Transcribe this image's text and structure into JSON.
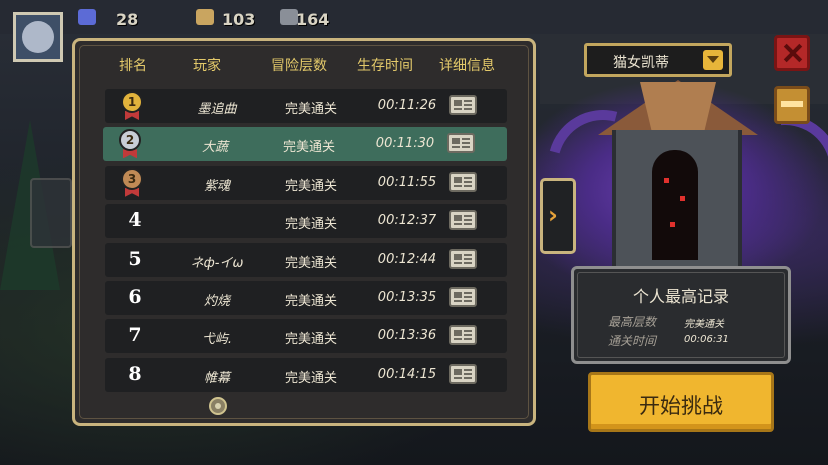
{
  "hud": {
    "gems": "28",
    "tokens": "103",
    "materials": "164"
  },
  "character_selector": {
    "selected": "猫女凯蒂"
  },
  "leaderboard": {
    "headers": [
      "排名",
      "玩家",
      "冒险层数",
      "生存时间",
      "详细信息"
    ],
    "rows": [
      {
        "rank": "1",
        "player": "墨追曲",
        "floors": "完美通关",
        "time": "00:11:26",
        "medal": "gold"
      },
      {
        "rank": "2",
        "player": "大蔬",
        "floors": "完美通关",
        "time": "00:11:30",
        "medal": "silver"
      },
      {
        "rank": "3",
        "player": "紫魂",
        "floors": "完美通关",
        "time": "00:11:55",
        "medal": "bronze"
      },
      {
        "rank": "4",
        "player": "",
        "floors": "完美通关",
        "time": "00:12:37"
      },
      {
        "rank": "5",
        "player": "ネф-イω",
        "floors": "完美通关",
        "time": "00:12:44"
      },
      {
        "rank": "6",
        "player": "灼烧",
        "floors": "完美通关",
        "time": "00:13:35"
      },
      {
        "rank": "7",
        "player": "弋屿.",
        "floors": "完美通关",
        "time": "00:13:36"
      },
      {
        "rank": "8",
        "player": "帷幕",
        "floors": "完美通关",
        "time": "00:14:15"
      }
    ]
  },
  "personal_best": {
    "title": "个人最高记录",
    "floors_label": "最高层数",
    "floors_value": "完美通关",
    "time_label": "通关时间",
    "time_value": "00:06:31"
  },
  "start_button": "开始挑战",
  "colors": {
    "header_text": "#e3c96a",
    "selected_row": "#3e6d5c",
    "panel_border": "#c9b47e",
    "start_button": "#f0b62f",
    "close_button": "#b42828"
  }
}
